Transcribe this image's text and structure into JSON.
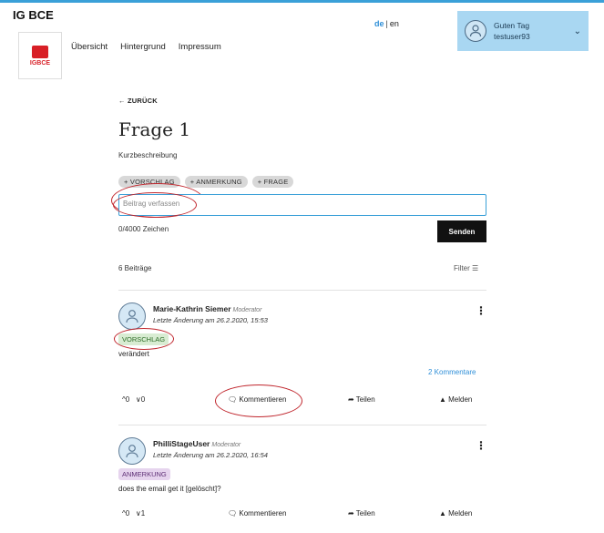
{
  "app": {
    "brand": "IG BCE",
    "logo_text": "IGBCE"
  },
  "nav": {
    "items": [
      "Übersicht",
      "Hintergrund",
      "Impressum"
    ]
  },
  "lang": {
    "active": "de",
    "separator": "|",
    "other": "en"
  },
  "user": {
    "greeting": "Guten Tag",
    "name": "testuser93"
  },
  "page": {
    "back": "← ZURÜCK",
    "title": "Frage 1",
    "subtitle": "Kurzbeschreibung",
    "tags": [
      "+ VORSCHLAG",
      "+ ANMERKUNG",
      "+ FRAGE"
    ],
    "input_placeholder": "Beitrag verfassen",
    "counter": "0/4000 Zeichen",
    "send": "Senden",
    "count": "6 Beiträge",
    "filter": "Filter ☰"
  },
  "posts": [
    {
      "author": "Marie-Kathrin Siemer",
      "role": "Moderator",
      "meta": "Letzte Änderung am 26.2.2020, 15:53",
      "badge": "VORSCHLAG",
      "body": "verändert",
      "comments_link": "2 Kommentare",
      "votes_up": "^0",
      "votes_down": "∨0",
      "comment": "🗨 Kommentieren",
      "share": "➦ Teilen",
      "report": "▲ Melden"
    },
    {
      "author": "PhilliStageUser",
      "role": "Moderator",
      "meta": "Letzte Änderung am 26.2.2020, 16:54",
      "badge": "ANMERKUNG",
      "body": "does the email get it [gelöscht]?",
      "votes_up": "^0",
      "votes_down": "∨1",
      "comment": "🗨 Kommentieren",
      "share": "➦ Teilen",
      "report": "▲ Melden"
    }
  ]
}
